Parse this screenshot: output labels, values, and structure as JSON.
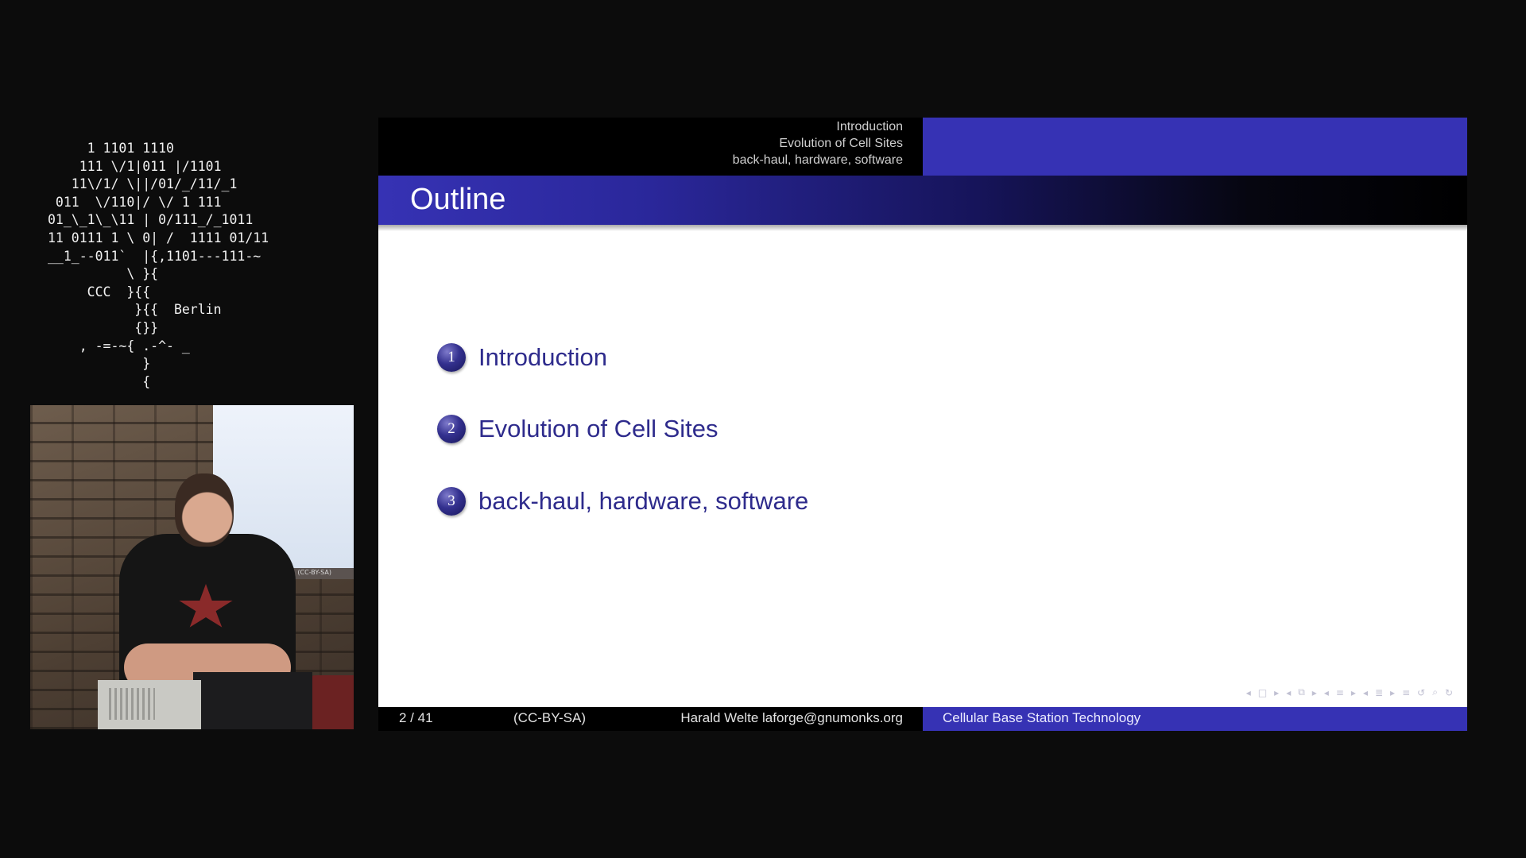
{
  "ascii_art": "     1 1101 1110\n    111 \\/1|011 |/1101\n   11\\/1/ \\||/01/_/11/_1\n 011  \\/110|/ \\/ 1 111\n01_\\_1\\_\\11 | 0/111_/_1011\n11 0111 1 \\ 0| /  1111 01/11\n__1_--011`  |{,1101---111-~\n          \\ }{\n     CCC  }{{\n           }{{  Berlin\n           {}}\n    , -=-~{ .-^- _\n            }\n            {",
  "camera": {
    "screen_label": "(CC-BY-SA)"
  },
  "slide": {
    "header_sections": [
      "Introduction",
      "Evolution of Cell Sites",
      "back-haul, hardware, software"
    ],
    "title": "Outline",
    "toc": [
      {
        "number": "1",
        "label": "Introduction"
      },
      {
        "number": "2",
        "label": "Evolution of Cell Sites"
      },
      {
        "number": "3",
        "label": "back-haul, hardware, software"
      }
    ],
    "footer": {
      "page": "2 / 41",
      "license": "(CC-BY-SA)",
      "author": "Harald Welte laforge@gnumonks.org",
      "title": "Cellular Base Station Technology"
    }
  },
  "colors": {
    "accent": "#3632b4",
    "toc_text": "#2e2b8c"
  }
}
